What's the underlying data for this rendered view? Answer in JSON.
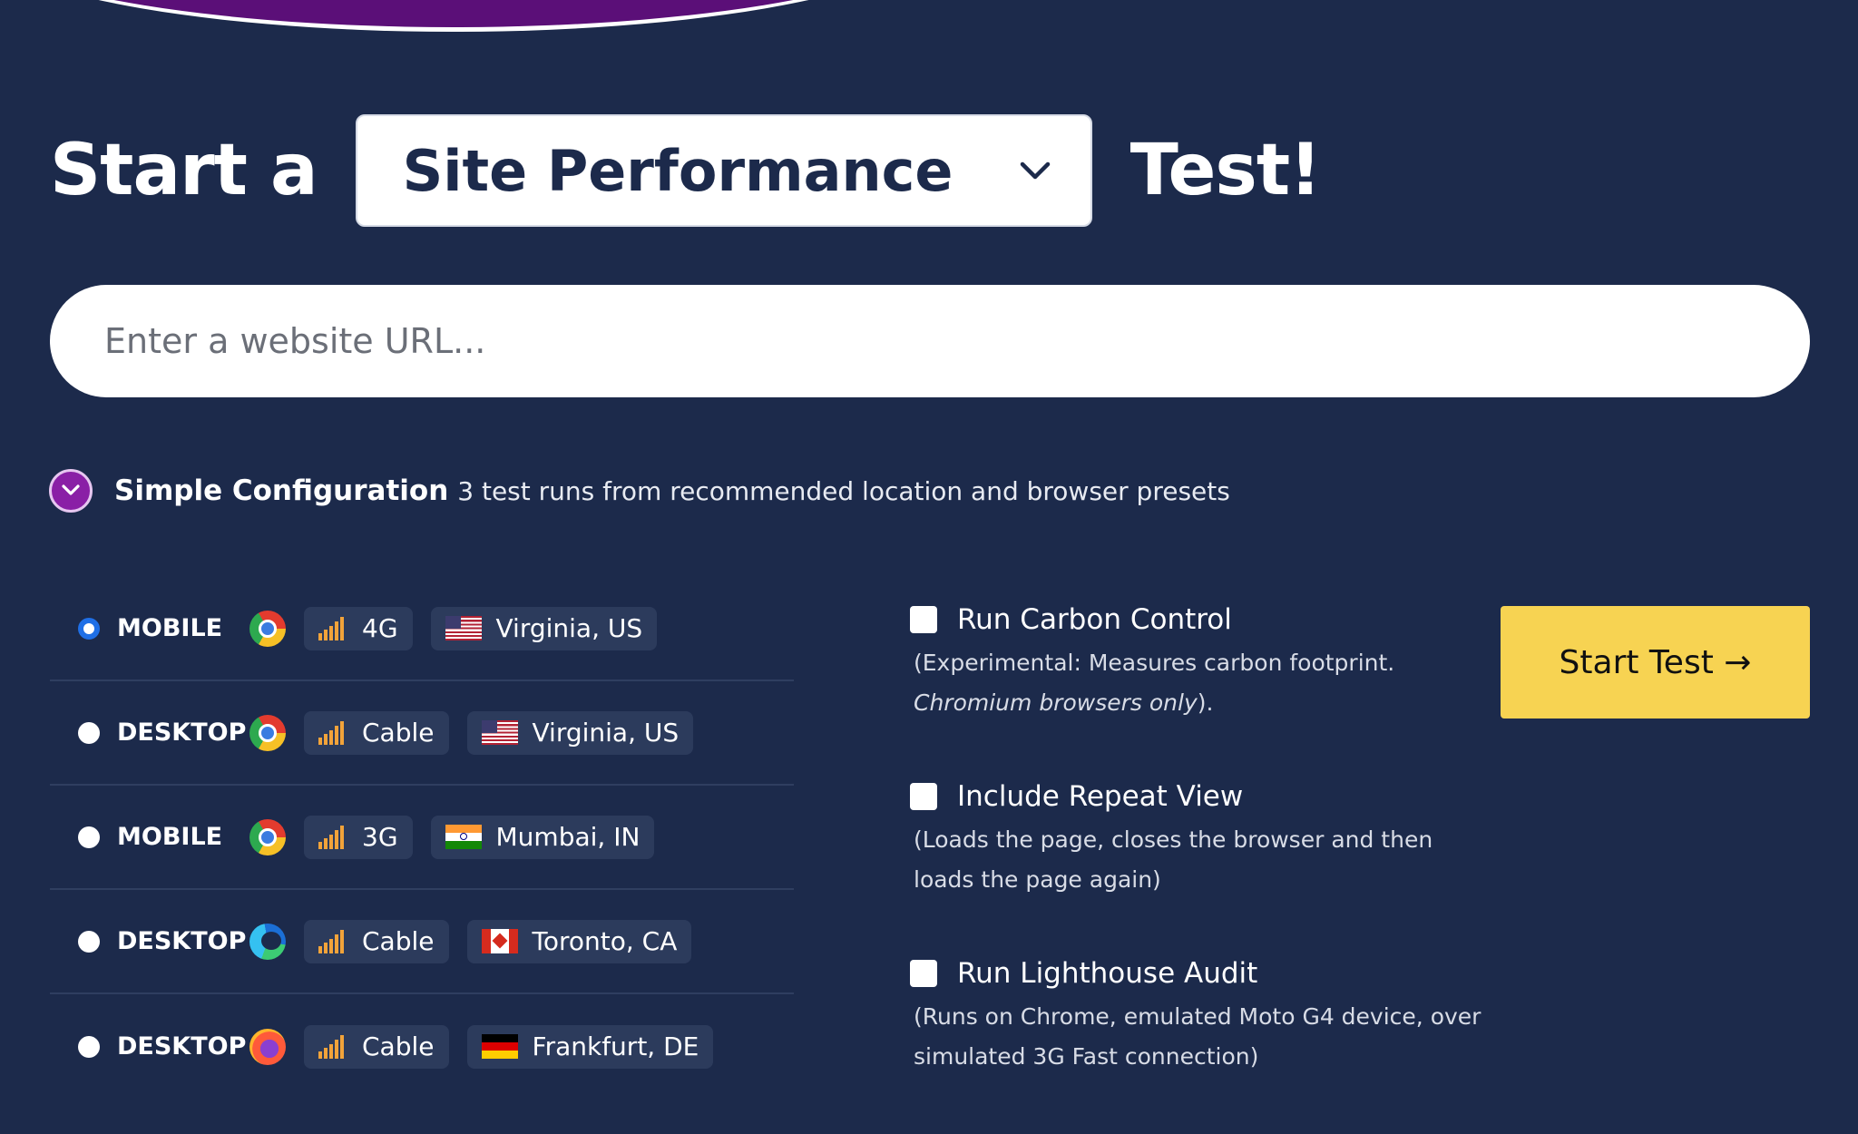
{
  "header": {
    "prefix": "Start a",
    "test_type": "Site Performance",
    "suffix": "Test!"
  },
  "url_input": {
    "placeholder": "Enter a website URL..."
  },
  "config": {
    "title": "Simple Configuration",
    "description": "3 test runs from recommended location and browser presets"
  },
  "presets": [
    {
      "device": "MOBILE",
      "browser": "chrome-icon",
      "connection": "4G",
      "location": "Virginia, US",
      "flag": "us-flag-icon",
      "selected": true
    },
    {
      "device": "DESKTOP",
      "browser": "chrome-icon",
      "connection": "Cable",
      "location": "Virginia, US",
      "flag": "us-flag-icon",
      "selected": false
    },
    {
      "device": "MOBILE",
      "browser": "chrome-icon",
      "connection": "3G",
      "location": "Mumbai, IN",
      "flag": "india-flag-icon",
      "selected": false
    },
    {
      "device": "DESKTOP",
      "browser": "edge-icon",
      "connection": "Cable",
      "location": "Toronto, CA",
      "flag": "canada-flag-icon",
      "selected": false
    },
    {
      "device": "DESKTOP",
      "browser": "firefox-icon",
      "connection": "Cable",
      "location": "Frankfurt, DE",
      "flag": "germany-flag-icon",
      "selected": false
    }
  ],
  "options": [
    {
      "label": "Run Carbon Control",
      "desc_main": "(Experimental: Measures carbon footprint.",
      "desc_em": "Chromium browsers only",
      "desc_end": ").",
      "checked": false
    },
    {
      "label": "Include Repeat View",
      "desc_main": "(Loads the page, closes the browser and then loads the page again)",
      "checked": false
    },
    {
      "label": "Run Lighthouse Audit",
      "desc_main": "(Runs on Chrome, emulated Moto G4 device, over simulated 3G Fast connection)",
      "checked": false
    }
  ],
  "start_button": {
    "label": "Start Test →"
  },
  "colors": {
    "background": "#1c2a4b",
    "accent_purple": "#8a1fa6",
    "start_button": "#f7d352",
    "radio_selected": "#1f6fe6",
    "signal": "#f2a33a"
  }
}
